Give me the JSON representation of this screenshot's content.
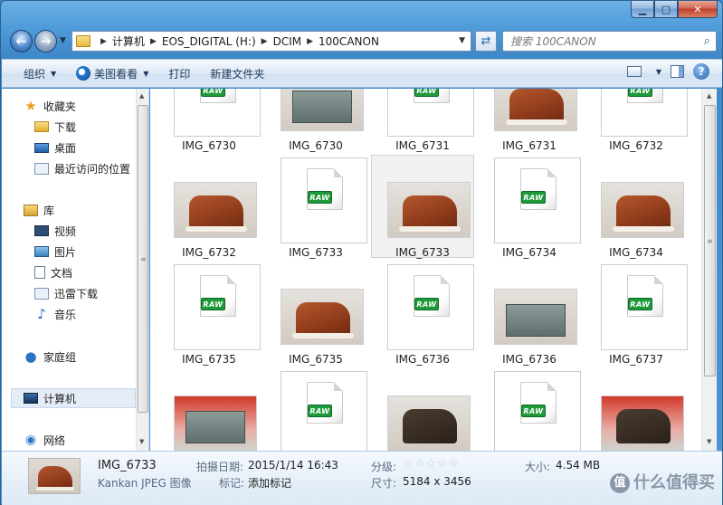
{
  "breadcrumb": [
    "计算机",
    "EOS_DIGITAL (H:)",
    "DCIM",
    "100CANON"
  ],
  "search": {
    "placeholder": "搜索 100CANON"
  },
  "toolbar": {
    "organize": "组织",
    "meitu": "美图看看",
    "print": "打印",
    "new_folder": "新建文件夹",
    "help": "?"
  },
  "sidebar": {
    "favorites": "收藏夹",
    "download": "下载",
    "desktop": "桌面",
    "recent": "最近访问的位置",
    "libraries": "库",
    "video": "视频",
    "pictures": "图片",
    "documents": "文档",
    "xunlei": "迅雷下载",
    "music": "音乐",
    "homegroup": "家庭组",
    "computer": "计算机",
    "network": "网络"
  },
  "files": [
    {
      "name": "IMG_6730",
      "kind": "raw"
    },
    {
      "name": "IMG_6730",
      "kind": "photo-box-label"
    },
    {
      "name": "IMG_6731",
      "kind": "raw"
    },
    {
      "name": "IMG_6731",
      "kind": "photo-boot"
    },
    {
      "name": "IMG_6732",
      "kind": "raw"
    },
    {
      "name": "IMG_6732",
      "kind": "photo-boot"
    },
    {
      "name": "IMG_6733",
      "kind": "raw"
    },
    {
      "name": "IMG_6733",
      "kind": "photo-boot",
      "selected": true
    },
    {
      "name": "IMG_6734",
      "kind": "raw"
    },
    {
      "name": "IMG_6734",
      "kind": "photo-boots"
    },
    {
      "name": "IMG_6735",
      "kind": "raw"
    },
    {
      "name": "IMG_6735",
      "kind": "photo-boot-side"
    },
    {
      "name": "IMG_6736",
      "kind": "raw"
    },
    {
      "name": "IMG_6736",
      "kind": "photo-box"
    },
    {
      "name": "IMG_6737",
      "kind": "raw"
    },
    {
      "name": "",
      "kind": "photo-box-red"
    },
    {
      "name": "",
      "kind": "raw"
    },
    {
      "name": "",
      "kind": "photo-dark"
    },
    {
      "name": "",
      "kind": "raw"
    },
    {
      "name": "",
      "kind": "photo-red-dark"
    }
  ],
  "raw_badge": "RAW",
  "details": {
    "name": "IMG_6733",
    "type": "Kankan JPEG 图像",
    "date_key": "拍摄日期:",
    "date_val": "2015/1/14 16:43",
    "tag_key": "标记:",
    "tag_val": "添加标记",
    "rating_key": "分级:",
    "rating_stars": "☆☆☆☆☆",
    "size_key": "大小:",
    "size_val": "4.54 MB",
    "dim_key": "尺寸:",
    "dim_val": "5184 x 3456"
  },
  "watermark": "什么值得买"
}
